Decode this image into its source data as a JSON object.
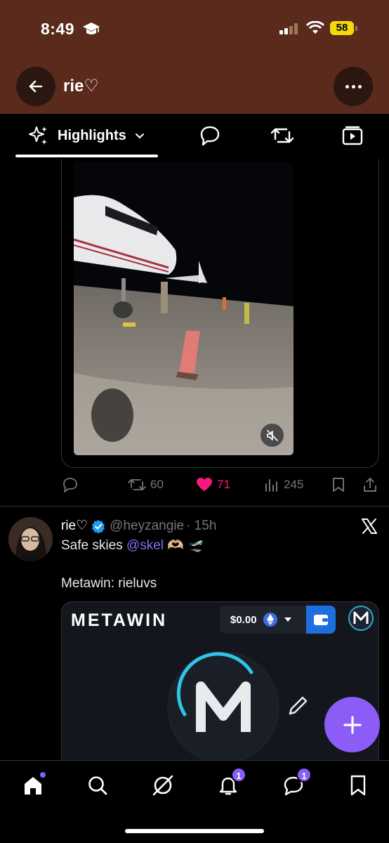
{
  "status_bar": {
    "time": "8:49",
    "battery": "58"
  },
  "header": {
    "title": "rie♡"
  },
  "tabs": {
    "highlights_label": "Highlights"
  },
  "post1": {
    "reply_count": "",
    "repost_count": "60",
    "like_count": "71",
    "view_count": "245"
  },
  "post2": {
    "name": "rie♡",
    "handle": "@heyzangie",
    "time": "· 15h",
    "text_before": "Safe skies ",
    "mention": "@skel",
    "text_after": " 🫶🏼 🛫",
    "text_line2": "Metawin: rieluvs"
  },
  "embed": {
    "logo": "METAWIN",
    "wallet_value": "$0.00"
  },
  "bottom_nav": {
    "notifications_badge": "1",
    "messages_badge": "1"
  },
  "colors": {
    "accent": "#8b5cf6",
    "header_bg": "#5a2a1c",
    "like": "#f91880"
  }
}
